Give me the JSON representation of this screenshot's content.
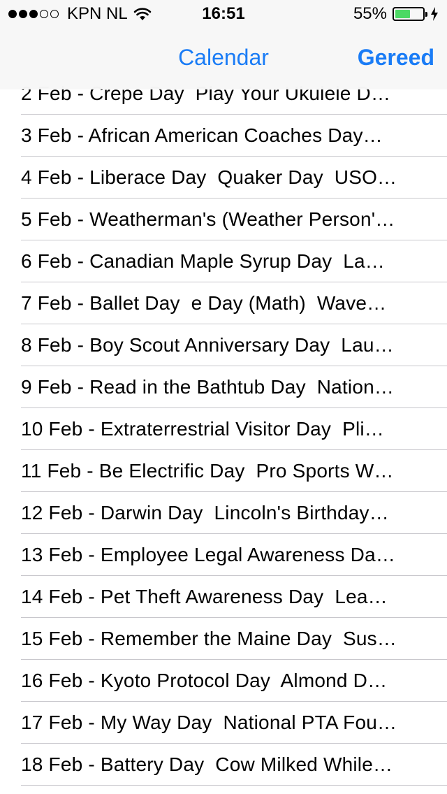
{
  "status_bar": {
    "carrier": "KPN NL",
    "time": "16:51",
    "battery_percent": "55%",
    "battery_level": 0.55,
    "signal_bars_filled": 3,
    "signal_bars_total": 5,
    "battery_color": "#4cd964"
  },
  "nav": {
    "title": "Calendar",
    "done_label": "Gereed",
    "accent_color": "#1a7cf6"
  },
  "rows": [
    "2 Feb - Crepe Day  Play Your Ukulele D…",
    "3 Feb - African American Coaches Day…",
    "4 Feb - Liberace Day  Quaker Day  USO…",
    "5 Feb - Weatherman's (Weather Person'…",
    "6 Feb - Canadian Maple Syrup Day  La…",
    "7 Feb - Ballet Day  e Day (Math)  Wave…",
    "8 Feb - Boy Scout Anniversary Day  Lau…",
    "9 Feb - Read in the Bathtub Day  Nation…",
    "10 Feb - Extraterrestrial Visitor Day  Pli…",
    "11 Feb - Be Electrific Day  Pro Sports W…",
    "12 Feb - Darwin Day  Lincoln's Birthday…",
    "13 Feb - Employee Legal Awareness Da…",
    "14 Feb - Pet Theft Awareness Day  Lea…",
    "15 Feb - Remember the Maine Day  Sus…",
    "16 Feb - Kyoto Protocol Day  Almond D…",
    "17 Feb - My Way Day  National PTA Fou…",
    "18 Feb - Battery Day  Cow Milked While…"
  ]
}
